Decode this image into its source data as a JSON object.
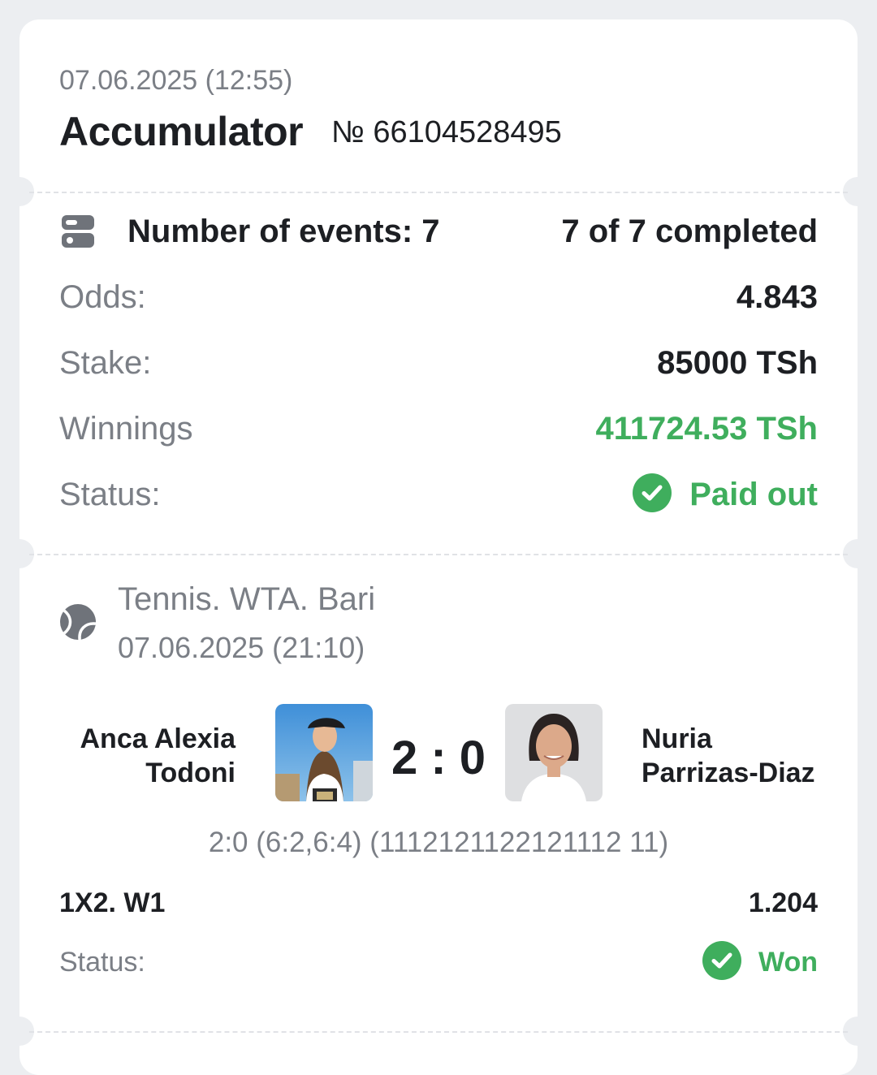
{
  "header": {
    "datetime": "07.06.2025 (12:55)",
    "bet_type": "Accumulator",
    "bet_number": "№ 66104528495"
  },
  "summary": {
    "events_label": "Number of events: 7",
    "completed": "7 of 7 completed",
    "odds_label": "Odds:",
    "odds_value": "4.843",
    "stake_label": "Stake:",
    "stake_value": "85000 TSh",
    "winnings_label": "Winnings",
    "winnings_value": "411724.53 TSh",
    "status_label": "Status:",
    "status_value": "Paid out"
  },
  "event": {
    "sport_league": "Tennis. WTA. Bari",
    "datetime": "07.06.2025 (21:10)",
    "player1_line1": "Anca Alexia",
    "player1_line2": "Todoni",
    "player2_line1": "Nuria",
    "player2_line2": "Parrizas-Diaz",
    "score": "2 : 0",
    "score_detail": "2:0 (6:2,6:4) (1112121122121112 11)",
    "market": "1X2. W1",
    "odds": "1.204",
    "status_label": "Status:",
    "status_value": "Won"
  },
  "colors": {
    "accent_green": "#3fae5d",
    "background": "#eceef1",
    "card": "#ffffff"
  },
  "icons": {
    "events": "list-toggle-icon",
    "sport": "tennis-ball-icon",
    "status": "check-circle-icon"
  }
}
